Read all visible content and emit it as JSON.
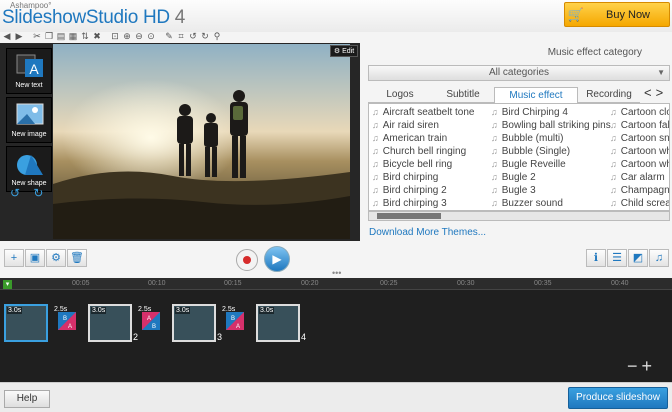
{
  "app": {
    "small_brand": "Ashampoo°",
    "name": "SlideshowStudio",
    "hd": "HD",
    "version": "4"
  },
  "buy": {
    "label": "Buy Now"
  },
  "stage": {
    "tools": [
      {
        "name": "new-text",
        "label": "New text"
      },
      {
        "name": "new-image",
        "label": "New image"
      },
      {
        "name": "new-shape",
        "label": "New shape"
      }
    ],
    "edit_label": "Edit"
  },
  "panel": {
    "category_label": "Music effect category",
    "category_value": "All categories",
    "tabs": [
      {
        "label": "Logos",
        "active": false
      },
      {
        "label": "Subtitle",
        "active": false
      },
      {
        "label": "Music effect",
        "active": true
      },
      {
        "label": "Recording",
        "active": false
      }
    ],
    "columns": [
      [
        "Aircraft seatbelt tone",
        "Air raid siren",
        "American train",
        "Church bell ringing",
        "Bicycle bell ring",
        "Bird chirping",
        "Bird chirping 2",
        "Bird chirping 3"
      ],
      [
        "Bird Chirping 4",
        "Bowling ball striking pins",
        "Bubble (multi)",
        "Bubble (Single)",
        "Bugle Reveille",
        "Bugle 2",
        "Bugle 3",
        "Buzzer sound"
      ],
      [
        "Cartoon cloc",
        "Cartoon falli",
        "Cartoon snea",
        "Cartoon whis",
        "Cartoon whis",
        "Car alarm",
        "Champagne",
        "Child scream"
      ]
    ],
    "download_label": "Download More Themes..."
  },
  "timeline": {
    "ruler": [
      "00:05",
      "00:10",
      "00:15",
      "00:20",
      "00:25",
      "00:30",
      "00:35",
      "00:40"
    ],
    "slides": [
      {
        "dur": "3.0s",
        "num": ""
      },
      {
        "dur": "3.0s",
        "num": "2"
      },
      {
        "dur": "3.0s",
        "num": "3"
      },
      {
        "dur": "3.0s",
        "num": "4"
      }
    ],
    "trans_dur": "2.5s",
    "zoom": "−+"
  },
  "footer": {
    "help": "Help",
    "produce": "Produce slideshow"
  }
}
